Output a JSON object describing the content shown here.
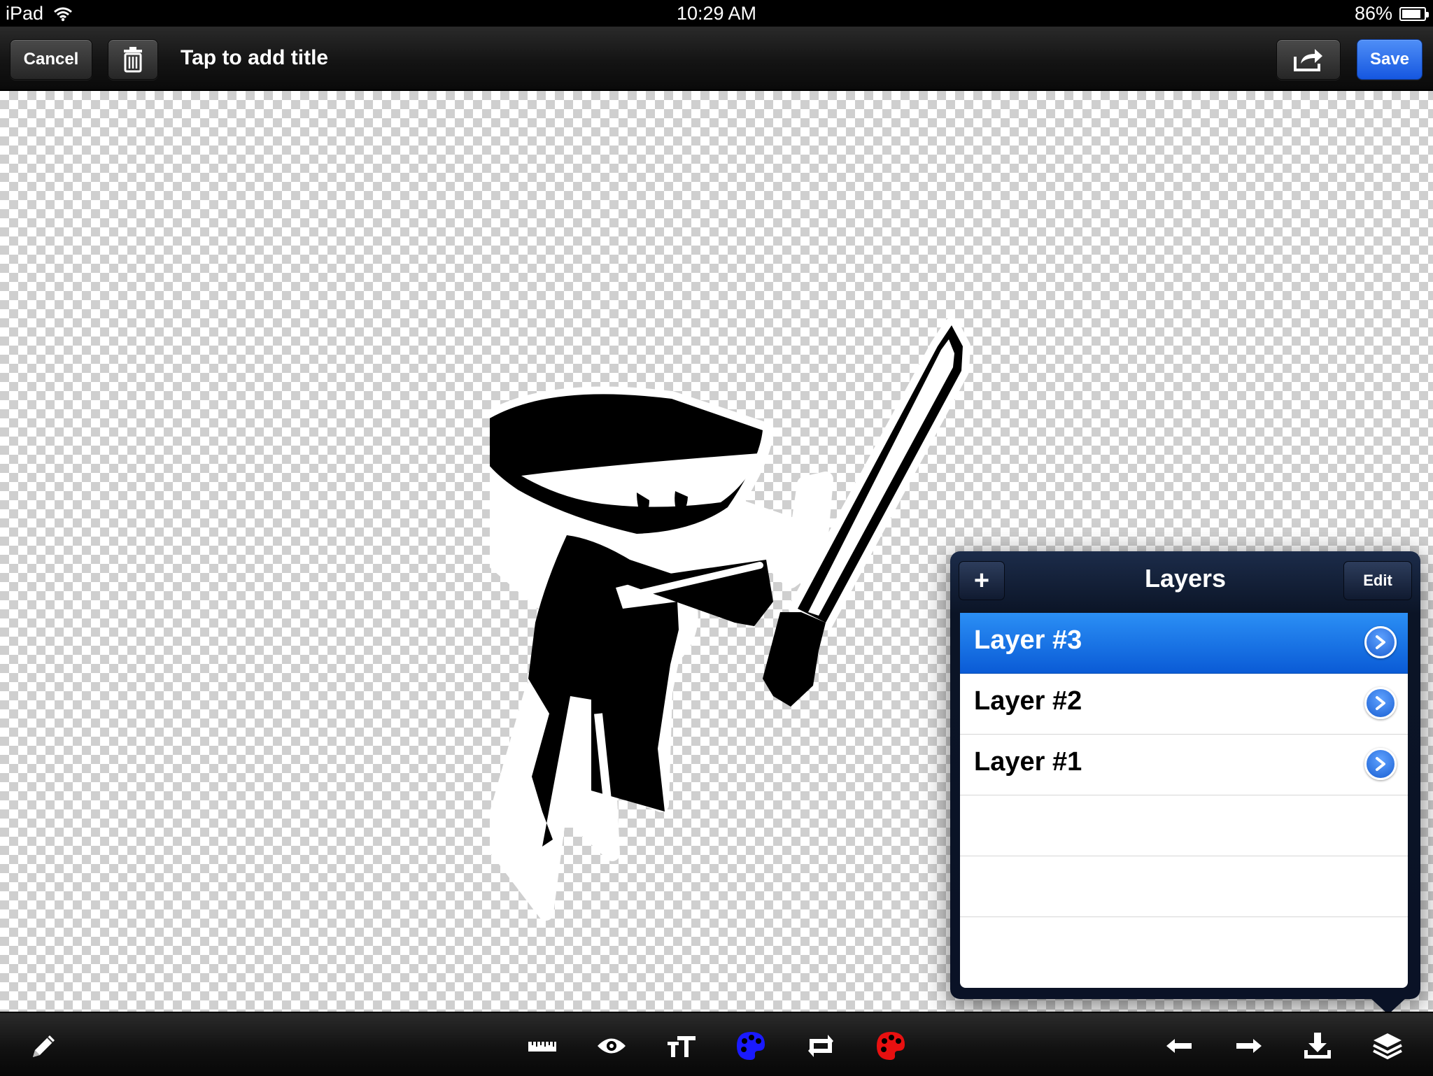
{
  "status_bar": {
    "device": "iPad",
    "time": "10:29 AM",
    "battery_percent": "86%",
    "battery_level": 0.86,
    "icons": [
      "wifi-icon",
      "battery-icon"
    ]
  },
  "toolbar": {
    "cancel_label": "Cancel",
    "title_placeholder": "Tap to add title",
    "save_label": "Save",
    "icons": [
      "trash-icon",
      "share-icon"
    ],
    "accent_color": "#1a63e6"
  },
  "layers_panel": {
    "title": "Layers",
    "add_label": "+",
    "edit_label": "Edit",
    "layers": [
      {
        "name": "Layer #3",
        "selected": true
      },
      {
        "name": "Layer #2",
        "selected": false
      },
      {
        "name": "Layer #1",
        "selected": false
      }
    ],
    "selected_color": "#0a6ce8"
  },
  "bottom_toolbar": {
    "tools": [
      "pencil-icon",
      "ruler-icon",
      "eye-icon",
      "text-size-icon",
      "palette-blue-icon",
      "transform-icon",
      "palette-red-icon",
      "undo-icon",
      "redo-icon",
      "download-icon",
      "layers-icon"
    ]
  }
}
